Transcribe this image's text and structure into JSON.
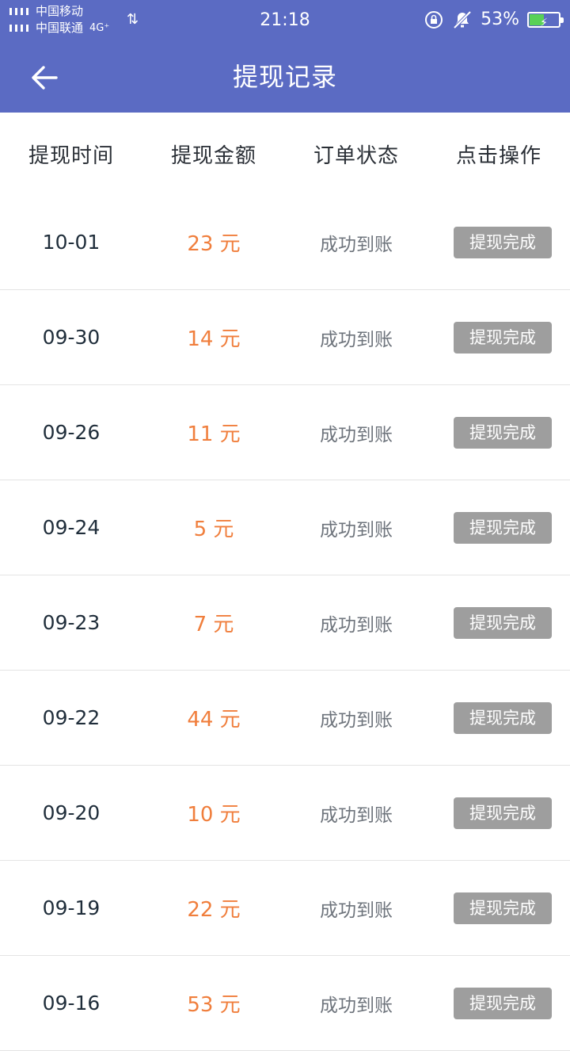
{
  "status_bar": {
    "carrier_1": "中国移动",
    "carrier_2": "中国联通",
    "network": "4G⁺",
    "time": "21:18",
    "battery_percent_label": "53%",
    "battery_level": 0.53,
    "icons": [
      "signal-icon",
      "data-activity-icon",
      "rotation-lock-icon",
      "mute-icon",
      "battery-charging-icon"
    ]
  },
  "header": {
    "title": "提现记录",
    "back_icon": "arrow-left-icon",
    "background_color": "#5b6bc3"
  },
  "table": {
    "columns": [
      "提现时间",
      "提现金额",
      "订单状态",
      "点击操作"
    ],
    "rows": [
      {
        "date": "10-01",
        "amount": "23 元",
        "status": "成功到账",
        "action": "提现完成"
      },
      {
        "date": "09-30",
        "amount": "14 元",
        "status": "成功到账",
        "action": "提现完成"
      },
      {
        "date": "09-26",
        "amount": "11 元",
        "status": "成功到账",
        "action": "提现完成"
      },
      {
        "date": "09-24",
        "amount": "5 元",
        "status": "成功到账",
        "action": "提现完成"
      },
      {
        "date": "09-23",
        "amount": "7 元",
        "status": "成功到账",
        "action": "提现完成"
      },
      {
        "date": "09-22",
        "amount": "44 元",
        "status": "成功到账",
        "action": "提现完成"
      },
      {
        "date": "09-20",
        "amount": "10 元",
        "status": "成功到账",
        "action": "提现完成"
      },
      {
        "date": "09-19",
        "amount": "22 元",
        "status": "成功到账",
        "action": "提现完成"
      },
      {
        "date": "09-16",
        "amount": "53 元",
        "status": "成功到账",
        "action": "提现完成"
      }
    ]
  },
  "colors": {
    "amount": "#f07e3c",
    "action_button": "#9e9e9e",
    "divider": "#e4e4e4"
  }
}
